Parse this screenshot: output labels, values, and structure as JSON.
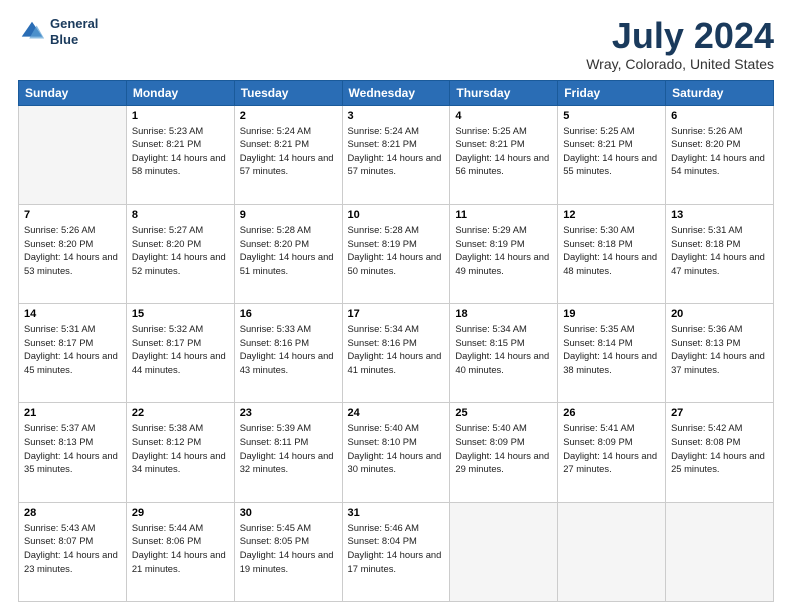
{
  "header": {
    "logo_line1": "General",
    "logo_line2": "Blue",
    "main_title": "July 2024",
    "subtitle": "Wray, Colorado, United States"
  },
  "calendar": {
    "days_of_week": [
      "Sunday",
      "Monday",
      "Tuesday",
      "Wednesday",
      "Thursday",
      "Friday",
      "Saturday"
    ],
    "weeks": [
      [
        {
          "day": "",
          "empty": true
        },
        {
          "day": "1",
          "sunrise": "Sunrise: 5:23 AM",
          "sunset": "Sunset: 8:21 PM",
          "daylight": "Daylight: 14 hours and 58 minutes."
        },
        {
          "day": "2",
          "sunrise": "Sunrise: 5:24 AM",
          "sunset": "Sunset: 8:21 PM",
          "daylight": "Daylight: 14 hours and 57 minutes."
        },
        {
          "day": "3",
          "sunrise": "Sunrise: 5:24 AM",
          "sunset": "Sunset: 8:21 PM",
          "daylight": "Daylight: 14 hours and 57 minutes."
        },
        {
          "day": "4",
          "sunrise": "Sunrise: 5:25 AM",
          "sunset": "Sunset: 8:21 PM",
          "daylight": "Daylight: 14 hours and 56 minutes."
        },
        {
          "day": "5",
          "sunrise": "Sunrise: 5:25 AM",
          "sunset": "Sunset: 8:21 PM",
          "daylight": "Daylight: 14 hours and 55 minutes."
        },
        {
          "day": "6",
          "sunrise": "Sunrise: 5:26 AM",
          "sunset": "Sunset: 8:20 PM",
          "daylight": "Daylight: 14 hours and 54 minutes."
        }
      ],
      [
        {
          "day": "7",
          "sunrise": "Sunrise: 5:26 AM",
          "sunset": "Sunset: 8:20 PM",
          "daylight": "Daylight: 14 hours and 53 minutes."
        },
        {
          "day": "8",
          "sunrise": "Sunrise: 5:27 AM",
          "sunset": "Sunset: 8:20 PM",
          "daylight": "Daylight: 14 hours and 52 minutes."
        },
        {
          "day": "9",
          "sunrise": "Sunrise: 5:28 AM",
          "sunset": "Sunset: 8:20 PM",
          "daylight": "Daylight: 14 hours and 51 minutes."
        },
        {
          "day": "10",
          "sunrise": "Sunrise: 5:28 AM",
          "sunset": "Sunset: 8:19 PM",
          "daylight": "Daylight: 14 hours and 50 minutes."
        },
        {
          "day": "11",
          "sunrise": "Sunrise: 5:29 AM",
          "sunset": "Sunset: 8:19 PM",
          "daylight": "Daylight: 14 hours and 49 minutes."
        },
        {
          "day": "12",
          "sunrise": "Sunrise: 5:30 AM",
          "sunset": "Sunset: 8:18 PM",
          "daylight": "Daylight: 14 hours and 48 minutes."
        },
        {
          "day": "13",
          "sunrise": "Sunrise: 5:31 AM",
          "sunset": "Sunset: 8:18 PM",
          "daylight": "Daylight: 14 hours and 47 minutes."
        }
      ],
      [
        {
          "day": "14",
          "sunrise": "Sunrise: 5:31 AM",
          "sunset": "Sunset: 8:17 PM",
          "daylight": "Daylight: 14 hours and 45 minutes."
        },
        {
          "day": "15",
          "sunrise": "Sunrise: 5:32 AM",
          "sunset": "Sunset: 8:17 PM",
          "daylight": "Daylight: 14 hours and 44 minutes."
        },
        {
          "day": "16",
          "sunrise": "Sunrise: 5:33 AM",
          "sunset": "Sunset: 8:16 PM",
          "daylight": "Daylight: 14 hours and 43 minutes."
        },
        {
          "day": "17",
          "sunrise": "Sunrise: 5:34 AM",
          "sunset": "Sunset: 8:16 PM",
          "daylight": "Daylight: 14 hours and 41 minutes."
        },
        {
          "day": "18",
          "sunrise": "Sunrise: 5:34 AM",
          "sunset": "Sunset: 8:15 PM",
          "daylight": "Daylight: 14 hours and 40 minutes."
        },
        {
          "day": "19",
          "sunrise": "Sunrise: 5:35 AM",
          "sunset": "Sunset: 8:14 PM",
          "daylight": "Daylight: 14 hours and 38 minutes."
        },
        {
          "day": "20",
          "sunrise": "Sunrise: 5:36 AM",
          "sunset": "Sunset: 8:13 PM",
          "daylight": "Daylight: 14 hours and 37 minutes."
        }
      ],
      [
        {
          "day": "21",
          "sunrise": "Sunrise: 5:37 AM",
          "sunset": "Sunset: 8:13 PM",
          "daylight": "Daylight: 14 hours and 35 minutes."
        },
        {
          "day": "22",
          "sunrise": "Sunrise: 5:38 AM",
          "sunset": "Sunset: 8:12 PM",
          "daylight": "Daylight: 14 hours and 34 minutes."
        },
        {
          "day": "23",
          "sunrise": "Sunrise: 5:39 AM",
          "sunset": "Sunset: 8:11 PM",
          "daylight": "Daylight: 14 hours and 32 minutes."
        },
        {
          "day": "24",
          "sunrise": "Sunrise: 5:40 AM",
          "sunset": "Sunset: 8:10 PM",
          "daylight": "Daylight: 14 hours and 30 minutes."
        },
        {
          "day": "25",
          "sunrise": "Sunrise: 5:40 AM",
          "sunset": "Sunset: 8:09 PM",
          "daylight": "Daylight: 14 hours and 29 minutes."
        },
        {
          "day": "26",
          "sunrise": "Sunrise: 5:41 AM",
          "sunset": "Sunset: 8:09 PM",
          "daylight": "Daylight: 14 hours and 27 minutes."
        },
        {
          "day": "27",
          "sunrise": "Sunrise: 5:42 AM",
          "sunset": "Sunset: 8:08 PM",
          "daylight": "Daylight: 14 hours and 25 minutes."
        }
      ],
      [
        {
          "day": "28",
          "sunrise": "Sunrise: 5:43 AM",
          "sunset": "Sunset: 8:07 PM",
          "daylight": "Daylight: 14 hours and 23 minutes."
        },
        {
          "day": "29",
          "sunrise": "Sunrise: 5:44 AM",
          "sunset": "Sunset: 8:06 PM",
          "daylight": "Daylight: 14 hours and 21 minutes."
        },
        {
          "day": "30",
          "sunrise": "Sunrise: 5:45 AM",
          "sunset": "Sunset: 8:05 PM",
          "daylight": "Daylight: 14 hours and 19 minutes."
        },
        {
          "day": "31",
          "sunrise": "Sunrise: 5:46 AM",
          "sunset": "Sunset: 8:04 PM",
          "daylight": "Daylight: 14 hours and 17 minutes."
        },
        {
          "day": "",
          "empty": true
        },
        {
          "day": "",
          "empty": true
        },
        {
          "day": "",
          "empty": true
        }
      ]
    ]
  }
}
